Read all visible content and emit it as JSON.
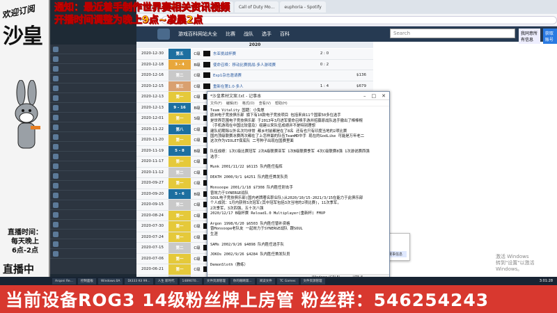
{
  "overlay": {
    "welcome": "欢迎订阅",
    "name": "沙皇",
    "schedule_1": "直播时间：",
    "schedule_2": "每天晚上",
    "schedule_3": "6点-2点",
    "live": "直播中",
    "notice_1": "通知：最近着手制作世界赛相关资讯视频",
    "notice_2": "开播时间调整为晚上9点~凌晨2点",
    "banner": "当前设备ROG3 14级粉丝牌上房管  粉丝群：546254243"
  },
  "browser": {
    "tabs": [
      "腾讯视频",
      "ezcore_game",
      "Liquipedia",
      "Call of Duty Mo...",
      "euphoria - Spotify"
    ],
    "nav": [
      "游戏百科网站大全",
      "比赛",
      "战队",
      "选手",
      "百科"
    ],
    "search_placeholder": "Search",
    "btn_1": "我同意所有信息",
    "btn_2": "获取账号"
  },
  "year_header": "2020",
  "rows": [
    {
      "date": "2020-12-30",
      "place": "第五",
      "color": "#1d6fa0",
      "tier": "C级",
      "name": "东亚挑战杯赛",
      "result": "2 : 0",
      "prize": ""
    },
    {
      "date": "2020-12-18",
      "place": "3 - 4",
      "color": "#e8a73c",
      "tier": "B级",
      "name": "使命召唤：移动比赛挑战-多人游戏赛",
      "result": "0 : 2",
      "prize": ""
    },
    {
      "date": "2020-12-16",
      "place": "第二",
      "color": "#c9c9c9",
      "tier": "C级",
      "name": "Esp1杂志邀请赛",
      "result": "",
      "prize": "$136"
    },
    {
      "date": "2020-12-15",
      "place": "第三",
      "color": "#d9a070",
      "tier": "C级",
      "name": "重新在第1.0·多人",
      "result": "1 : 4",
      "prize": "$679"
    },
    {
      "date": "2020-12-13",
      "place": "第一",
      "color": "#e5c93a",
      "tier": "C级",
      "name": "大搜·狂热的所有战争",
      "result": "2 : 0",
      "prize": ""
    },
    {
      "date": "2020-12-13",
      "place": "9 - 16",
      "color": "#1d6fa0",
      "tier": "B级",
      "name": "天游COD决赛选手",
      "result": "0 : 2",
      "prize": ""
    },
    {
      "date": "2020-12-01",
      "place": "第一",
      "color": "#e5c93a",
      "tier": "S级",
      "name": "Hign CODM专业",
      "result": "2 : 0",
      "prize": ""
    },
    {
      "date": "2020-11-22",
      "place": "第八",
      "color": "#1d6fa0",
      "tier": "C级",
      "name": "那时电子竞技年5年竞技场",
      "result": "1 : 4",
      "prize": ""
    },
    {
      "date": "2020-11-20",
      "place": "第一",
      "color": "#e5c93a",
      "tier": "C级",
      "name": "Locop战场联盟",
      "result": "2 : 1",
      "prize": ""
    },
    {
      "date": "2020-11-19",
      "place": "5 - 8",
      "color": "#1d6fa0",
      "tier": "B级",
      "name": "使命召唤：移动初级选赛事",
      "result": "0 : 2",
      "prize": ""
    },
    {
      "date": "2020-11-17",
      "place": "第一",
      "color": "#e5c93a",
      "tier": "C级",
      "name": "战队大赛",
      "result": "3 : 1",
      "prize": ""
    },
    {
      "date": "2020-11-12",
      "place": "第二",
      "color": "#c9c9c9",
      "tier": "C级",
      "name": "Locop战场最高联赛",
      "result": "1 : 2",
      "prize": ""
    },
    {
      "date": "2020-09-27",
      "place": "第一",
      "color": "#e5c93a",
      "tier": "C级",
      "name": "2020世界移动电竞锦标赛-东亚和亚州",
      "result": "3 : 0",
      "prize": ""
    },
    {
      "date": "2020-09-20",
      "place": "5 - 6",
      "color": "#1d6fa0",
      "tier": "B级",
      "name": "全球电子竞技锦标赛-移动联盟",
      "result": "0 : 2",
      "prize": ""
    },
    {
      "date": "2020-09-15",
      "place": "第二",
      "color": "#c9c9c9",
      "tier": "C级",
      "name": "Clasen高级联盟",
      "result": "",
      "prize": ""
    },
    {
      "date": "2020-08-24",
      "place": "第一",
      "color": "#e5c93a",
      "tier": "C级",
      "name": "圣殿战争-第一季(多人)",
      "result": "",
      "prize": ""
    },
    {
      "date": "2020-07-30",
      "place": "第一",
      "color": "#e5c93a",
      "tier": "C级",
      "name": "Esp1 x PFG电子竞技移动使命召唤 - 移动联赛",
      "result": "",
      "prize": ""
    },
    {
      "date": "2020-07-24",
      "place": "第一",
      "color": "#e5c93a",
      "tier": "C级",
      "name": "圣殿战争-第一季(多人游戏)",
      "result": "",
      "prize": ""
    },
    {
      "date": "2020-07-15",
      "place": "第二",
      "color": "#c9c9c9",
      "tier": "C级",
      "name": "",
      "result": "",
      "prize": ""
    },
    {
      "date": "2020-07-06",
      "place": "第一",
      "color": "#e5c93a",
      "tier": "C级",
      "name": "",
      "result": "",
      "prize": ""
    },
    {
      "date": "2020-06-21",
      "place": "第一",
      "color": "#e5c93a",
      "tier": "C级",
      "name": "",
      "result": "",
      "prize": ""
    },
    {
      "date": "2020-06-05",
      "place": "第二",
      "color": "#c9c9c9",
      "tier": "C级",
      "name": "全球电竞赛",
      "result": "",
      "prize": ""
    },
    {
      "date": "",
      "place": "第一",
      "color": "#e5c93a",
      "tier": "C级",
      "name": "天启大满贯",
      "result": "",
      "prize": ""
    }
  ],
  "popup": {
    "title": "ILLusion CoDM League",
    "button": "前往此赛事信息"
  },
  "notepad": {
    "title": "*沙皇素材文案.txt - 记事本",
    "menu": [
      "文件(F)",
      "编辑(E)",
      "格式(O)",
      "查看(V)",
      "帮助(H)"
    ],
    "text": "Team Vitality 国籍：小兔崽\n欧洲电子竞技俱乐部 旗下有10款电子竞技项目 包括来自11个国家50多位选手\n是世界范围电子竞技俱乐部 于2013年3月进军使命召唤手游并招募原战队选手撤出了棒棒棍\n（手机游戏在中国比较普及）组建以来队伍成绩并不是特别理想\n建队初期除以外名次均非常 都乡村前都是在了8名 还有也只有印度当地的2项比赛\n国内顶级联赛冰赛两次都在了上怎样最的队伍TeamMD中手 现在的GodLike 可能是万年老二\n这次作为VIOLET保底队 二号种子出现在国赛里面\n\n队伍成绩：1次C级比赛冠军 2次A级联赛亚军 1次B级联赛季军 4次C级联赛8强 1次游说赛西强\n选手：\n\nMunk 2001/11/22 $6115 队内胜任指挥\n\nDEATH 2000/9/1 $4251 队内胜任首发队员\n\nMonsoope 2001/1/18 $7308 队内胜任射击手\n曾效力于SYNERGE战队\nSOUL电子竞技俱乐部(国内老牌著名职业队)从2020/10/15-2021/3/15在能力于此俱乐部\n个人成就：1月内获得3次冠军(其中冠军包括3次当地的2项比赛)，11次季军，\n2次季军，3次四强，五十次八强\n2020/12/17 B级杯赛 Reload1.0 Multiplayer(重新杯) FMVP\n\nArgon 1998/6/20 $6503 队内胜任替补资格\n曾Monsoope老队友 一起效力于SYNERGE战队 跟SOUL\n生涯\n\nSAMs 2002/9/26 $4898 队内胜任选手队\n\nJOKOs 2002/9/26 $4284 队内胜任首发队员\n\nDemonSloth（教练）",
    "status_1": "Windows (CRLF)",
    "status_2": "UTF-8"
  },
  "activate": "激活 Windows\n转到\"设置\"以激活 Windows。",
  "taskbar": {
    "items": [
      "Arqoni Re...",
      "控制面板",
      "Windows.0A",
      "Dt333 Kil 99...",
      "人生 新时代",
      "1489070...",
      "文件资源管理",
      "你的眼睛第...",
      "阅读文件",
      "TC Games",
      "文件资源管理"
    ],
    "clock": "3:01:28"
  }
}
